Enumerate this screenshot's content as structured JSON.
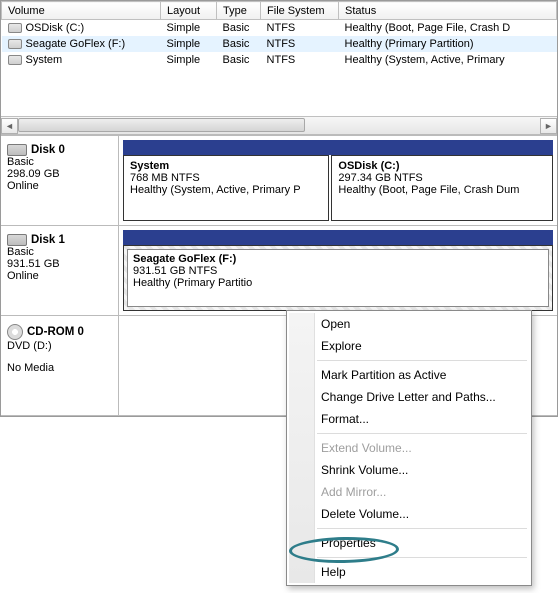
{
  "columns": {
    "c0": "Volume",
    "c1": "Layout",
    "c2": "Type",
    "c3": "File System",
    "c4": "Status"
  },
  "volumes": [
    {
      "name": "OSDisk (C:)",
      "layout": "Simple",
      "type": "Basic",
      "fs": "NTFS",
      "status": "Healthy (Boot, Page File, Crash D",
      "selected": false
    },
    {
      "name": "Seagate GoFlex (F:)",
      "layout": "Simple",
      "type": "Basic",
      "fs": "NTFS",
      "status": "Healthy (Primary Partition)",
      "selected": true
    },
    {
      "name": "System",
      "layout": "Simple",
      "type": "Basic",
      "fs": "NTFS",
      "status": "Healthy (System, Active, Primary",
      "selected": false
    }
  ],
  "disk0": {
    "title": "Disk 0",
    "line1": "Basic",
    "line2": "298.09 GB",
    "line3": "Online",
    "partA": {
      "name": "System",
      "size": "768 MB NTFS",
      "health": "Healthy (System, Active, Primary P"
    },
    "partB": {
      "name": "OSDisk  (C:)",
      "size": "297.34 GB NTFS",
      "health": "Healthy (Boot, Page File, Crash Dum"
    }
  },
  "disk1": {
    "title": "Disk 1",
    "line1": "Basic",
    "line2": "931.51 GB",
    "line3": "Online",
    "partA": {
      "name": "Seagate GoFlex  (F:)",
      "size": "931.51 GB NTFS",
      "health": "Healthy (Primary Partitio"
    }
  },
  "cdrom": {
    "title": "CD-ROM 0",
    "line1": "DVD (D:)",
    "line2": "No Media"
  },
  "menu": {
    "open": "Open",
    "explore": "Explore",
    "markactive": "Mark Partition as Active",
    "changedrive": "Change Drive Letter and Paths...",
    "format": "Format...",
    "extend": "Extend Volume...",
    "shrink": "Shrink Volume...",
    "addmirror": "Add Mirror...",
    "deletevol": "Delete Volume...",
    "properties": "Properties",
    "help": "Help"
  }
}
